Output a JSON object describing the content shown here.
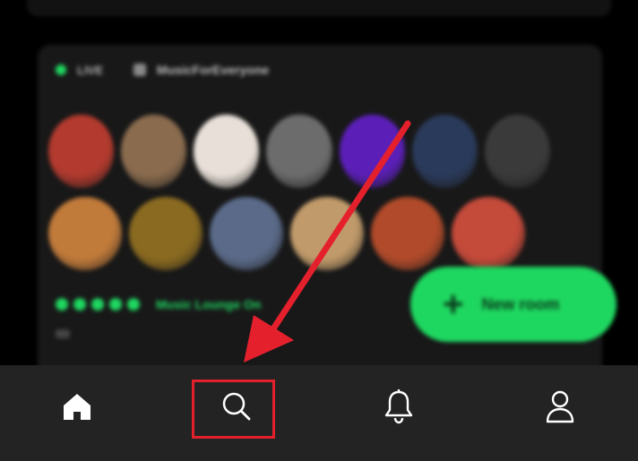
{
  "room": {
    "live_label": "LIVE",
    "room_name": "MusicForEveryone",
    "title_text": "Music Lounge On",
    "accent_color": "#1ed760",
    "avatar_colors": [
      [
        "#b23a2e",
        "#8a6b4e",
        "#e8e0d8",
        "#6c6c6c",
        "#5b1fb8",
        "#2a3a5a",
        "#3a3a3a"
      ],
      [
        "#c07a3a",
        "#8a6a20",
        "#5a6a88",
        "#c09a6a",
        "#b04a2a",
        "#c44a3a"
      ]
    ]
  },
  "fab": {
    "icon": "plus-icon",
    "label": "New room"
  },
  "navbar": {
    "items": [
      {
        "name": "Home",
        "icon": "home-icon"
      },
      {
        "name": "Search",
        "icon": "search-icon"
      },
      {
        "name": "Notifications",
        "icon": "bell-icon"
      },
      {
        "name": "Profile",
        "icon": "profile-icon"
      }
    ],
    "background": "#232323"
  },
  "annotation": {
    "highlight_color": "#e5202d",
    "target": "search-icon"
  }
}
